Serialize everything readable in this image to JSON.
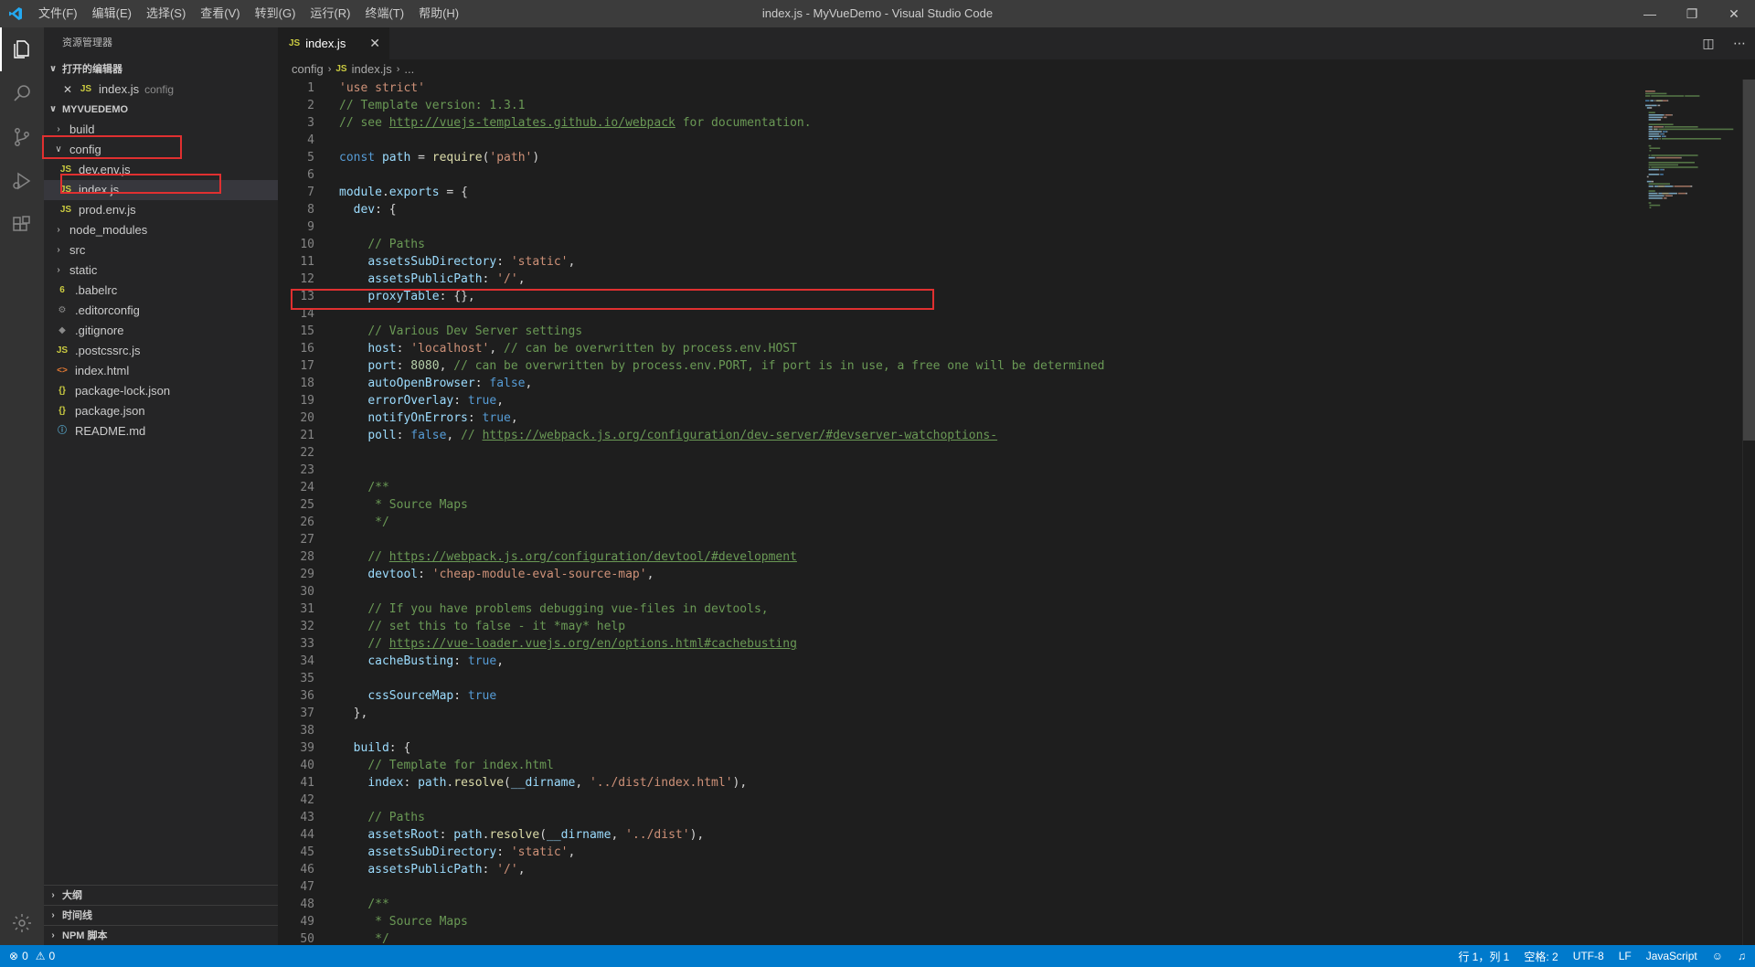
{
  "titlebar": {
    "menu": [
      "文件(F)",
      "编辑(E)",
      "选择(S)",
      "查看(V)",
      "转到(G)",
      "运行(R)",
      "终端(T)",
      "帮助(H)"
    ],
    "window_title": "index.js - MyVueDemo - Visual Studio Code",
    "controls": [
      "minimize",
      "restore",
      "close"
    ]
  },
  "activitybar": [
    "files-icon",
    "search-icon",
    "source-control-icon",
    "run-debug-icon",
    "extensions-icon"
  ],
  "sidebar": {
    "title": "资源管理器",
    "open_editors": {
      "header": "打开的编辑器",
      "items": [
        {
          "icon": "JS",
          "name": "index.js",
          "desc": "config"
        }
      ]
    },
    "project": {
      "header": "MYVUEDEMO",
      "items": [
        {
          "label": "build",
          "type": "folder",
          "expanded": false,
          "depth": 0
        },
        {
          "label": "config",
          "type": "folder",
          "expanded": true,
          "depth": 0
        },
        {
          "label": "dev.env.js",
          "type": "js",
          "icon": "JS",
          "depth": 1
        },
        {
          "label": "index.js",
          "type": "js",
          "icon": "JS",
          "depth": 1
        },
        {
          "label": "prod.env.js",
          "type": "js",
          "icon": "JS",
          "depth": 1
        },
        {
          "label": "node_modules",
          "type": "folder",
          "expanded": false,
          "depth": 0
        },
        {
          "label": "src",
          "type": "folder",
          "expanded": false,
          "depth": 0
        },
        {
          "label": "static",
          "type": "folder",
          "expanded": false,
          "depth": 0
        },
        {
          "label": ".babelrc",
          "type": "babel",
          "icon": "6",
          "depth": 0
        },
        {
          "label": ".editorconfig",
          "type": "cfg",
          "icon": "⚙",
          "depth": 0
        },
        {
          "label": ".gitignore",
          "type": "cfg",
          "icon": "◆",
          "depth": 0
        },
        {
          "label": ".postcssrc.js",
          "type": "js",
          "icon": "JS",
          "depth": 0
        },
        {
          "label": "index.html",
          "type": "html",
          "icon": "<>",
          "depth": 0
        },
        {
          "label": "package-lock.json",
          "type": "json",
          "icon": "{}",
          "depth": 0
        },
        {
          "label": "package.json",
          "type": "json",
          "icon": "{}",
          "depth": 0
        },
        {
          "label": "README.md",
          "type": "md",
          "icon": "ⓘ",
          "depth": 0
        }
      ]
    },
    "bottom_sections": [
      "大纲",
      "时间线",
      "NPM 脚本"
    ]
  },
  "editor": {
    "tab": {
      "icon": "JS",
      "label": "index.js"
    },
    "breadcrumb": {
      "folder": "config",
      "file": "index.js",
      "more": "..."
    },
    "lines": [
      [
        [
          "s",
          "'use strict'"
        ]
      ],
      [
        [
          "c",
          "// Template version: 1.3.1"
        ]
      ],
      [
        [
          "c",
          "// see "
        ],
        [
          "cu",
          "http://vuejs-templates.github.io/webpack"
        ],
        [
          "c",
          " for documentation."
        ]
      ],
      [],
      [
        [
          "k",
          "const "
        ],
        [
          "p",
          "path"
        ],
        [
          "t",
          " = "
        ],
        [
          "f",
          "require"
        ],
        [
          "t",
          "("
        ],
        [
          "s",
          "'path'"
        ],
        [
          "t",
          ")"
        ]
      ],
      [],
      [
        [
          "p",
          "module"
        ],
        [
          "t",
          "."
        ],
        [
          "p",
          "exports"
        ],
        [
          "t",
          " = {"
        ]
      ],
      [
        [
          "t",
          "  "
        ],
        [
          "p",
          "dev"
        ],
        [
          "t",
          ": {"
        ]
      ],
      [],
      [
        [
          "t",
          "    "
        ],
        [
          "c",
          "// Paths"
        ]
      ],
      [
        [
          "t",
          "    "
        ],
        [
          "p",
          "assetsSubDirectory"
        ],
        [
          "t",
          ": "
        ],
        [
          "s",
          "'static'"
        ],
        [
          "t",
          ","
        ]
      ],
      [
        [
          "t",
          "    "
        ],
        [
          "p",
          "assetsPublicPath"
        ],
        [
          "t",
          ": "
        ],
        [
          "s",
          "'/'"
        ],
        [
          "t",
          ","
        ]
      ],
      [
        [
          "t",
          "    "
        ],
        [
          "p",
          "proxyTable"
        ],
        [
          "t",
          ": {},"
        ]
      ],
      [],
      [
        [
          "t",
          "    "
        ],
        [
          "c",
          "// Various Dev Server settings"
        ]
      ],
      [
        [
          "t",
          "    "
        ],
        [
          "p",
          "host"
        ],
        [
          "t",
          ": "
        ],
        [
          "s",
          "'localhost'"
        ],
        [
          "t",
          ", "
        ],
        [
          "c",
          "// can be overwritten by process.env.HOST"
        ]
      ],
      [
        [
          "t",
          "    "
        ],
        [
          "p",
          "port"
        ],
        [
          "t",
          ": "
        ],
        [
          "n",
          "8080"
        ],
        [
          "t",
          ", "
        ],
        [
          "c",
          "// can be overwritten by process.env.PORT, if port is in use, a free one will be determined"
        ]
      ],
      [
        [
          "t",
          "    "
        ],
        [
          "p",
          "autoOpenBrowser"
        ],
        [
          "t",
          ": "
        ],
        [
          "k",
          "false"
        ],
        [
          "t",
          ","
        ]
      ],
      [
        [
          "t",
          "    "
        ],
        [
          "p",
          "errorOverlay"
        ],
        [
          "t",
          ": "
        ],
        [
          "k",
          "true"
        ],
        [
          "t",
          ","
        ]
      ],
      [
        [
          "t",
          "    "
        ],
        [
          "p",
          "notifyOnErrors"
        ],
        [
          "t",
          ": "
        ],
        [
          "k",
          "true"
        ],
        [
          "t",
          ","
        ]
      ],
      [
        [
          "t",
          "    "
        ],
        [
          "p",
          "poll"
        ],
        [
          "t",
          ": "
        ],
        [
          "k",
          "false"
        ],
        [
          "t",
          ", "
        ],
        [
          "c",
          "// "
        ],
        [
          "cu",
          "https://webpack.js.org/configuration/dev-server/#devserver-watchoptions-"
        ]
      ],
      [],
      [],
      [
        [
          "t",
          "    "
        ],
        [
          "c",
          "/**"
        ]
      ],
      [
        [
          "t",
          "     "
        ],
        [
          "c",
          "* Source Maps"
        ]
      ],
      [
        [
          "t",
          "     "
        ],
        [
          "c",
          "*/"
        ]
      ],
      [],
      [
        [
          "t",
          "    "
        ],
        [
          "c",
          "// "
        ],
        [
          "cu",
          "https://webpack.js.org/configuration/devtool/#development"
        ]
      ],
      [
        [
          "t",
          "    "
        ],
        [
          "p",
          "devtool"
        ],
        [
          "t",
          ": "
        ],
        [
          "s",
          "'cheap-module-eval-source-map'"
        ],
        [
          "t",
          ","
        ]
      ],
      [],
      [
        [
          "t",
          "    "
        ],
        [
          "c",
          "// If you have problems debugging vue-files in devtools,"
        ]
      ],
      [
        [
          "t",
          "    "
        ],
        [
          "c",
          "// set this to false - it *may* help"
        ]
      ],
      [
        [
          "t",
          "    "
        ],
        [
          "c",
          "// "
        ],
        [
          "cu",
          "https://vue-loader.vuejs.org/en/options.html#cachebusting"
        ]
      ],
      [
        [
          "t",
          "    "
        ],
        [
          "p",
          "cacheBusting"
        ],
        [
          "t",
          ": "
        ],
        [
          "k",
          "true"
        ],
        [
          "t",
          ","
        ]
      ],
      [],
      [
        [
          "t",
          "    "
        ],
        [
          "p",
          "cssSourceMap"
        ],
        [
          "t",
          ": "
        ],
        [
          "k",
          "true"
        ]
      ],
      [
        [
          "t",
          "  },"
        ]
      ],
      [],
      [
        [
          "t",
          "  "
        ],
        [
          "p",
          "build"
        ],
        [
          "t",
          ": {"
        ]
      ],
      [
        [
          "t",
          "    "
        ],
        [
          "c",
          "// Template for index.html"
        ]
      ],
      [
        [
          "t",
          "    "
        ],
        [
          "p",
          "index"
        ],
        [
          "t",
          ": "
        ],
        [
          "p",
          "path"
        ],
        [
          "t",
          "."
        ],
        [
          "f",
          "resolve"
        ],
        [
          "t",
          "("
        ],
        [
          "p",
          "__dirname"
        ],
        [
          "t",
          ", "
        ],
        [
          "s",
          "'../dist/index.html'"
        ],
        [
          "t",
          "),"
        ]
      ],
      [],
      [
        [
          "t",
          "    "
        ],
        [
          "c",
          "// Paths"
        ]
      ],
      [
        [
          "t",
          "    "
        ],
        [
          "p",
          "assetsRoot"
        ],
        [
          "t",
          ": "
        ],
        [
          "p",
          "path"
        ],
        [
          "t",
          "."
        ],
        [
          "f",
          "resolve"
        ],
        [
          "t",
          "("
        ],
        [
          "p",
          "__dirname"
        ],
        [
          "t",
          ", "
        ],
        [
          "s",
          "'../dist'"
        ],
        [
          "t",
          "),"
        ]
      ],
      [
        [
          "t",
          "    "
        ],
        [
          "p",
          "assetsSubDirectory"
        ],
        [
          "t",
          ": "
        ],
        [
          "s",
          "'static'"
        ],
        [
          "t",
          ","
        ]
      ],
      [
        [
          "t",
          "    "
        ],
        [
          "p",
          "assetsPublicPath"
        ],
        [
          "t",
          ": "
        ],
        [
          "s",
          "'/'"
        ],
        [
          "t",
          ","
        ]
      ],
      [],
      [
        [
          "t",
          "    "
        ],
        [
          "c",
          "/**"
        ]
      ],
      [
        [
          "t",
          "     "
        ],
        [
          "c",
          "* Source Maps"
        ]
      ],
      [
        [
          "t",
          "     "
        ],
        [
          "c",
          "*/"
        ]
      ]
    ]
  },
  "statusbar": {
    "errors": "0",
    "warnings": "0",
    "position": "行 1，列 1",
    "spaces": "空格: 2",
    "encoding": "UTF-8",
    "eol": "LF",
    "language": "JavaScript"
  },
  "colors": {
    "status_bar": "#007acc",
    "highlight_box": "#e03030"
  }
}
